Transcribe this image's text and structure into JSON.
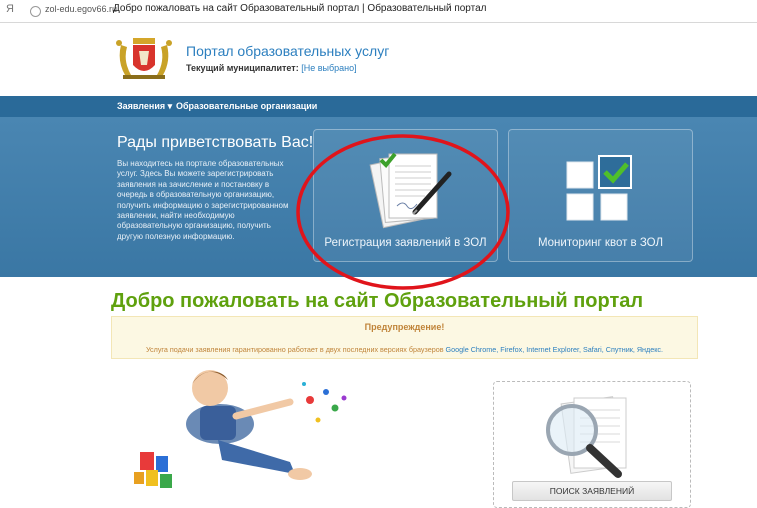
{
  "browser": {
    "url": "zol-edu.egov66.ru",
    "page_title": "Добро пожаловать на сайт Образовательный портал | Образовательный портал"
  },
  "header": {
    "site_title": "Портал образовательных услуг",
    "municipality_label": "Текущий муниципалитет:",
    "municipality_value": "[Не выбрано]"
  },
  "nav": {
    "items": [
      {
        "label": "Заявления ▾"
      },
      {
        "label": "Образовательные организации"
      }
    ]
  },
  "hero": {
    "title": "Рады приветствовать Вас!",
    "text": "Вы находитесь на портале образовательных услуг. Здесь Вы можете зарегистрировать заявления на зачисление и постановку в очередь в образовательную организацию, получить информацию о зарегистрированном заявлении, найти необходимую образовательную организацию, получить другую полезную информацию.",
    "cards": [
      {
        "label": "Регистрация заявлений в ЗОЛ"
      },
      {
        "label": "Мониторинг квот в ЗОЛ"
      }
    ]
  },
  "main": {
    "welcome": "Добро пожаловать на сайт Образовательный портал",
    "warning_title": "Предупреждение!",
    "warning_text": "Услуга подачи заявления гарантированно работает в двух последних версиях браузеров",
    "browsers": [
      "Google Chrome,",
      "Firefox,",
      "Internet Explorer,",
      "Safari,",
      "Спутник,",
      "Яндекс."
    ],
    "search_button": "ПОИСК ЗАЯВЛЕНИЙ"
  },
  "colors": {
    "nav_bg": "#2a6a99",
    "hero_bg": "#3e7aa8",
    "welcome_green": "#5fa10e",
    "link_blue": "#2c7fbf",
    "annotation_red": "#e0141b"
  }
}
